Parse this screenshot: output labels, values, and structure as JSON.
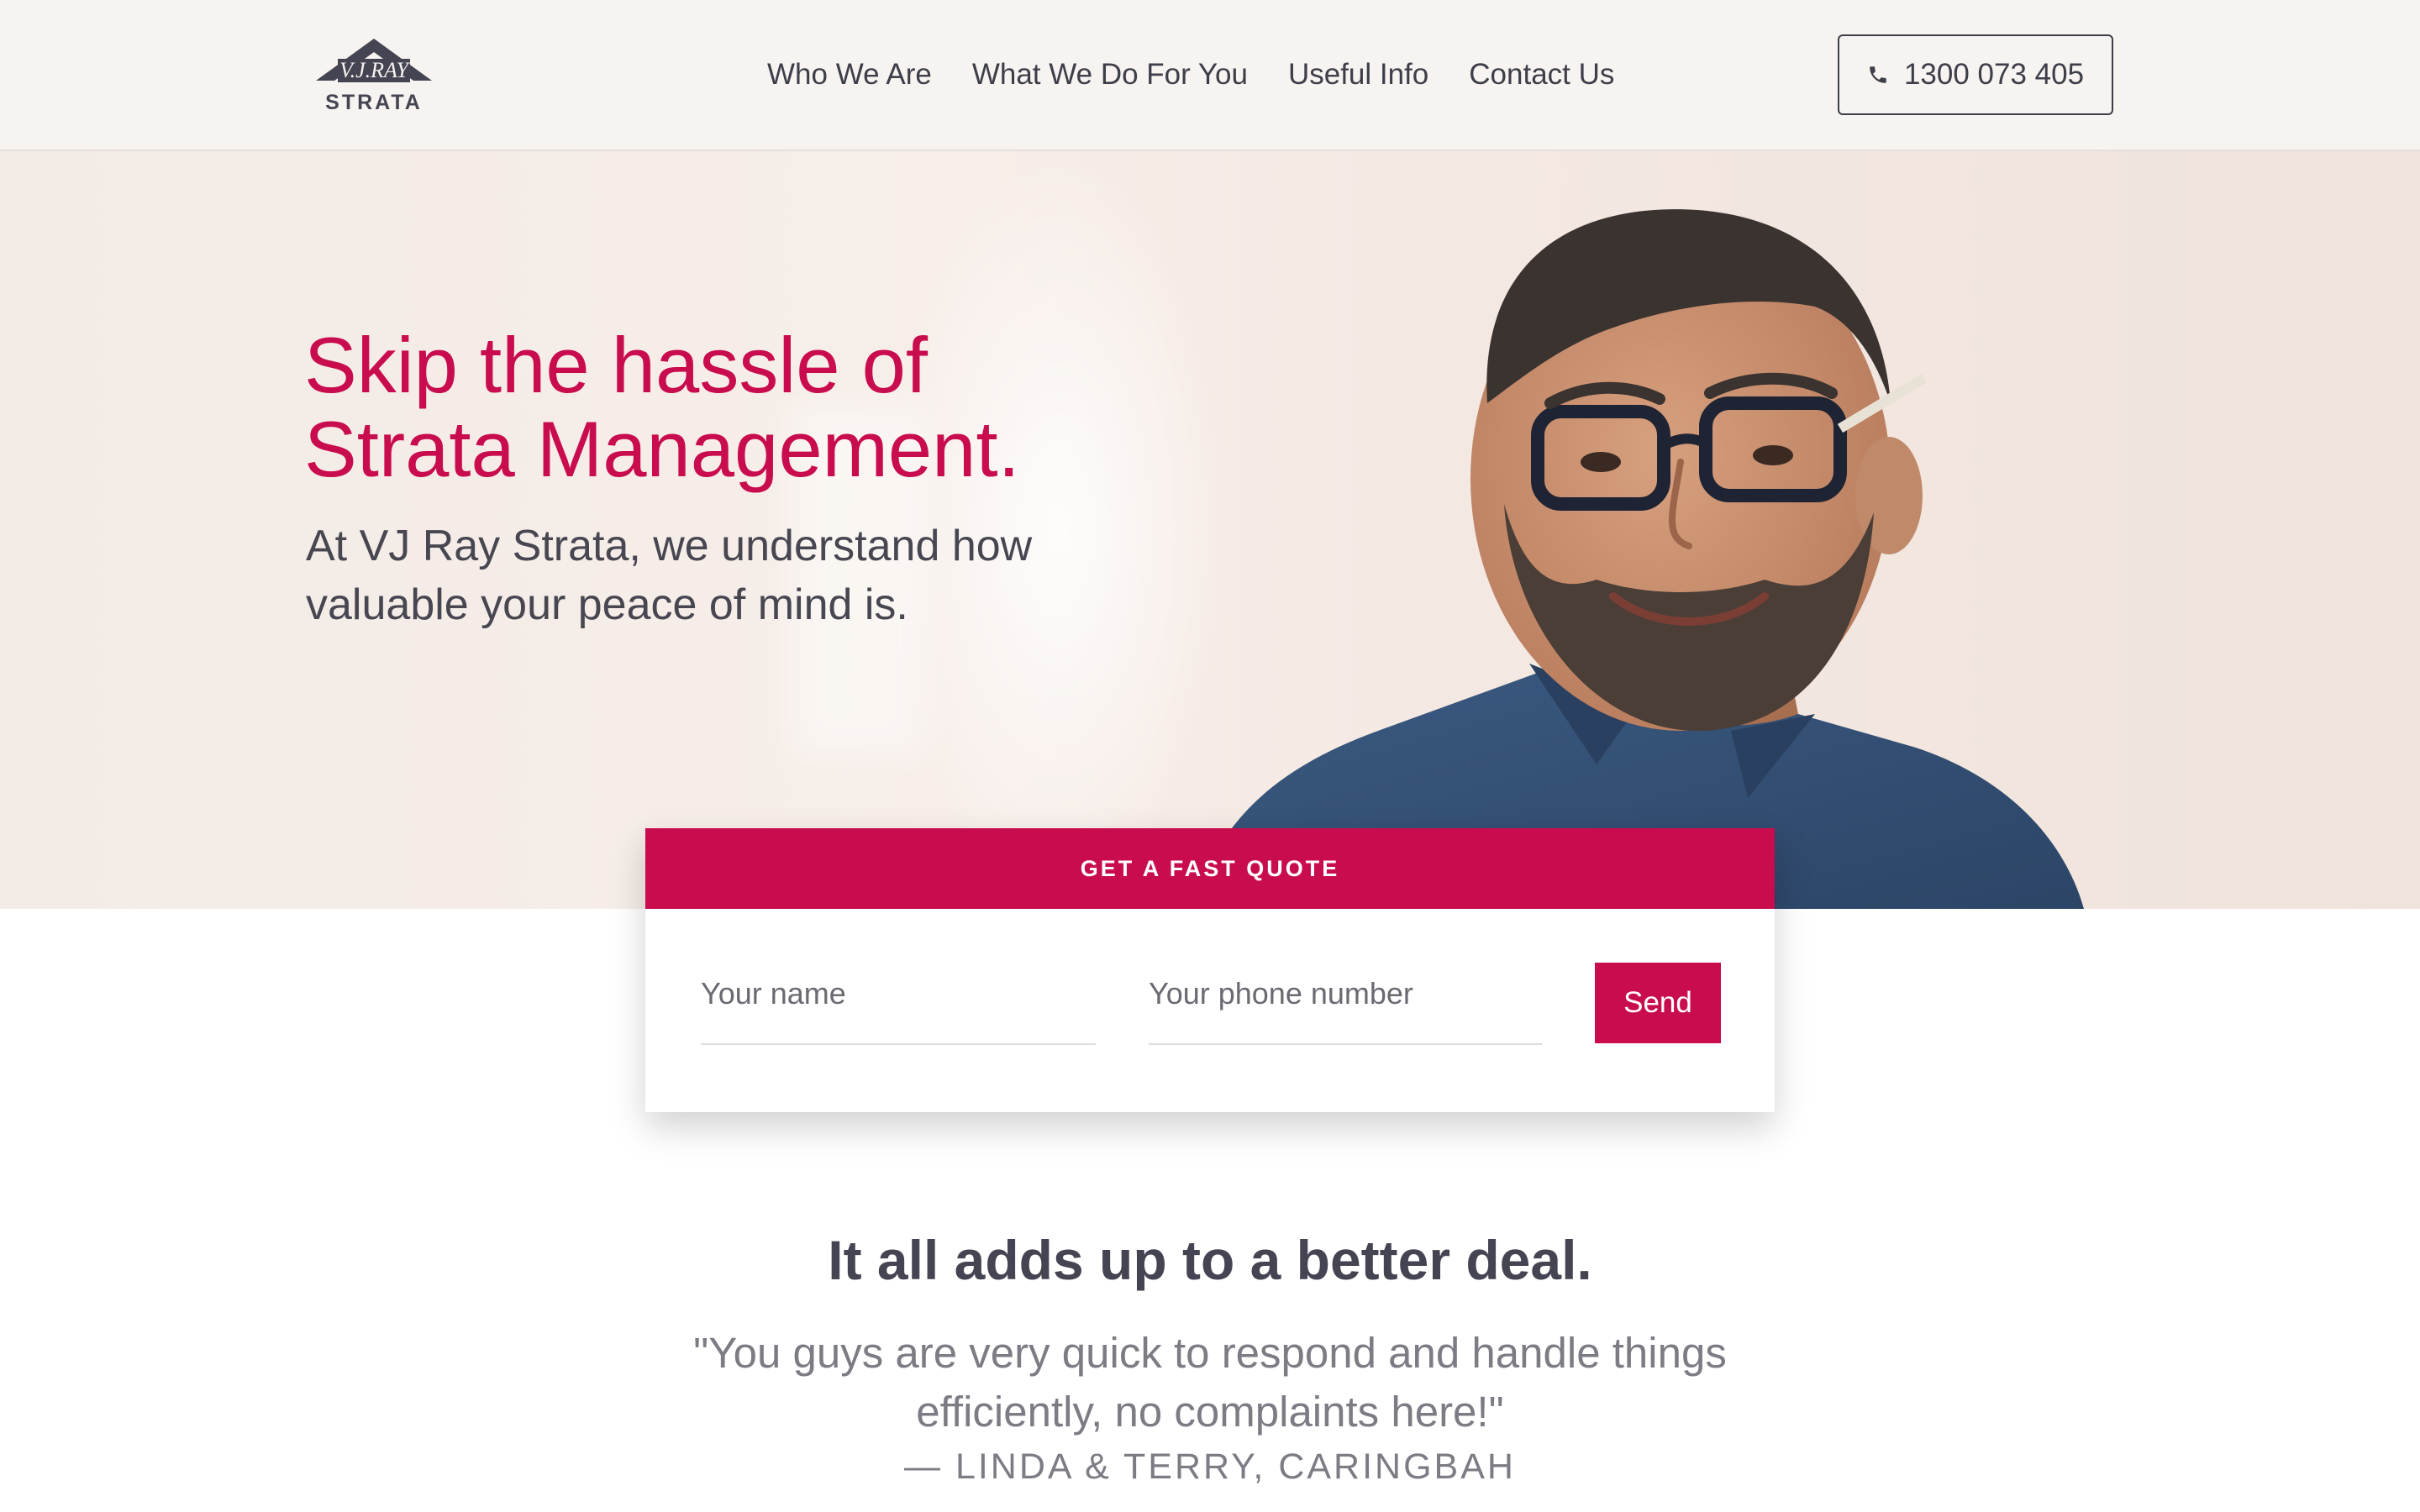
{
  "header": {
    "logo": {
      "brand_mark": "V.J.RAY",
      "wordmark": "STRATA"
    },
    "nav": [
      {
        "label": "Who We Are"
      },
      {
        "label": "What We Do For You"
      },
      {
        "label": "Useful Info"
      },
      {
        "label": "Contact Us"
      }
    ],
    "phone": {
      "icon": "phone-icon",
      "label": "1300 073 405"
    }
  },
  "hero": {
    "title": "Skip the hassle of Strata Management.",
    "subtitle": "At VJ Ray Strata, we understand how valuable your peace of mind is."
  },
  "quote_form": {
    "heading": "GET A FAST QUOTE",
    "name_placeholder": "Your name",
    "phone_placeholder": "Your phone number",
    "send_label": "Send"
  },
  "testimonial_section": {
    "title": "It all adds up to a better deal.",
    "quote": "\"You guys are very quick to respond and handle things efficiently, no complaints here!\"",
    "attribution": "— LINDA & TERRY, CARINGBAH"
  },
  "colors": {
    "accent": "#c80c4e",
    "text_dark": "#454452",
    "text_muted": "#7d7c85",
    "header_bg": "#f7f3f0"
  }
}
